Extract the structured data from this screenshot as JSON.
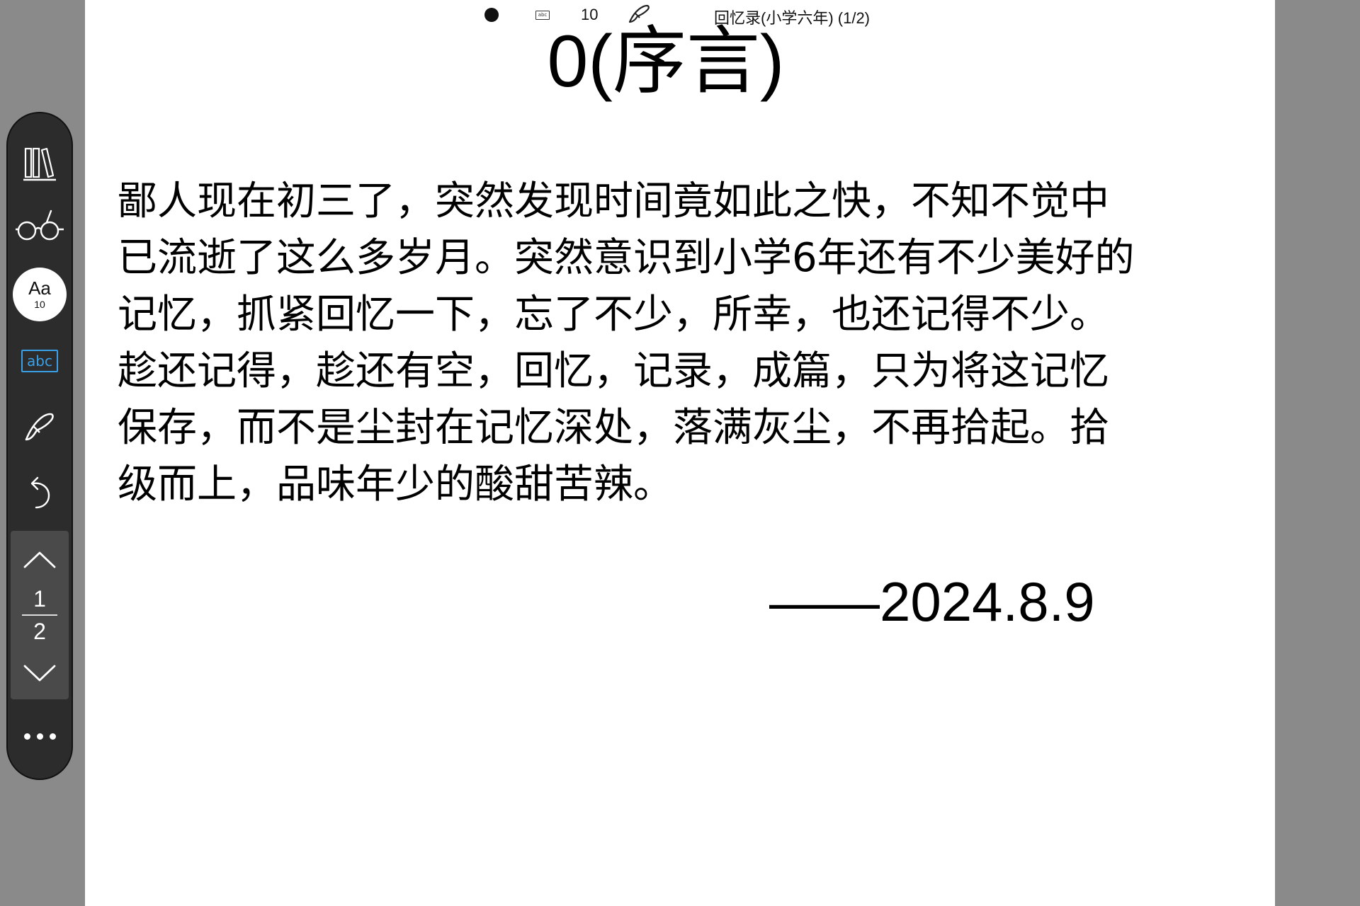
{
  "status_bar": {
    "abc_label": "abc",
    "font_size": "10",
    "book_title": "回忆录(小学六年) (1/2)"
  },
  "document": {
    "title": "0(序言)",
    "body_lines": [
      "鄙人现在初三了，突然发现时间竟如此之快，不知不觉中",
      "已流逝了这么多岁月。突然意识到小学6年还有不少美好的",
      "记忆，抓紧回忆一下，忘了不少，所幸，也还记得不少。",
      "趁还记得，趁还有空，回忆，记录，成篇，只为将这记忆",
      "保存，而不是尘封在记忆深处，落满灰尘，不再拾起。拾",
      "级而上，品味年少的酸甜苦辣。"
    ],
    "date": "——2024.8.9"
  },
  "toolbar": {
    "font_button": {
      "label": "Aa",
      "size": "10"
    },
    "abc_label": "abc",
    "pager": {
      "current": "1",
      "total": "2"
    }
  },
  "icons": {
    "library": "library-icon",
    "reading_glasses": "glasses-icon",
    "pen": "pen-icon",
    "undo": "undo-icon",
    "page_up": "chevron-up-icon",
    "page_down": "chevron-down-icon",
    "more": "more-icon"
  },
  "colors": {
    "page_background": "#ffffff",
    "side_background": "#8a8a8a",
    "toolbar_background": "#2c2c2c",
    "pager_background": "#4a4a4a",
    "accent": "#3aa0e8",
    "text": "#000000"
  }
}
